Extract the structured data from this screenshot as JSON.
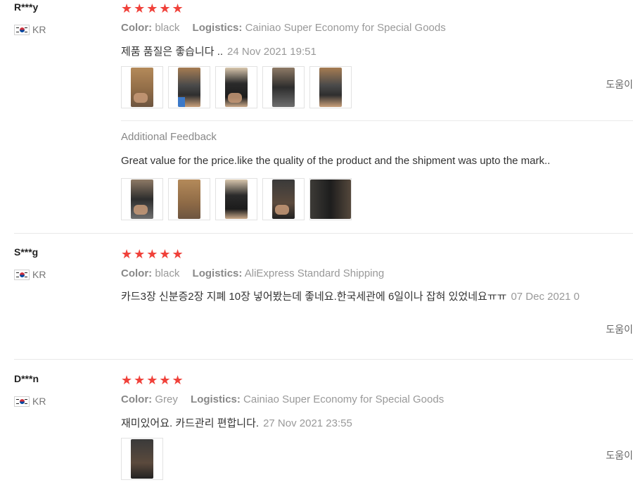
{
  "reviews": [
    {
      "user": "R***y",
      "country": "KR",
      "stars": "★★★★★",
      "color_label": "Color:",
      "color_value": "black",
      "logistics_label": "Logistics:",
      "logistics_value": "Cainiao Super Economy for Special Goods",
      "text": "제품 품질은 좋습니다 ..",
      "date": "24 Nov 2021 19:51",
      "helpful": "도움이",
      "additional_label": "Additional Feedback",
      "additional_text": "Great value for the price.like the quality of the product and the shipment was upto the mark.."
    },
    {
      "user": "S***g",
      "country": "KR",
      "stars": "★★★★★",
      "color_label": "Color:",
      "color_value": "black",
      "logistics_label": "Logistics:",
      "logistics_value": "AliExpress Standard Shipping",
      "text": "카드3장 신분증2장 지폐 10장 넣어봤는데 좋네요.한국세관에 6일이나 잡혀 있었네요ㅠㅠ",
      "date": "07 Dec 2021 0",
      "helpful": "도움이"
    },
    {
      "user": "D***n",
      "country": "KR",
      "stars": "★★★★★",
      "color_label": "Color:",
      "color_value": "Grey",
      "logistics_label": "Logistics:",
      "logistics_value": "Cainiao Super Economy for Special Goods",
      "text": "재미있어요. 카드관리 편합니다.",
      "date": "27 Nov 2021 23:55",
      "helpful": "도움이"
    }
  ],
  "colors": {
    "star": "#f0413a",
    "muted": "#999999",
    "text": "#333333"
  }
}
